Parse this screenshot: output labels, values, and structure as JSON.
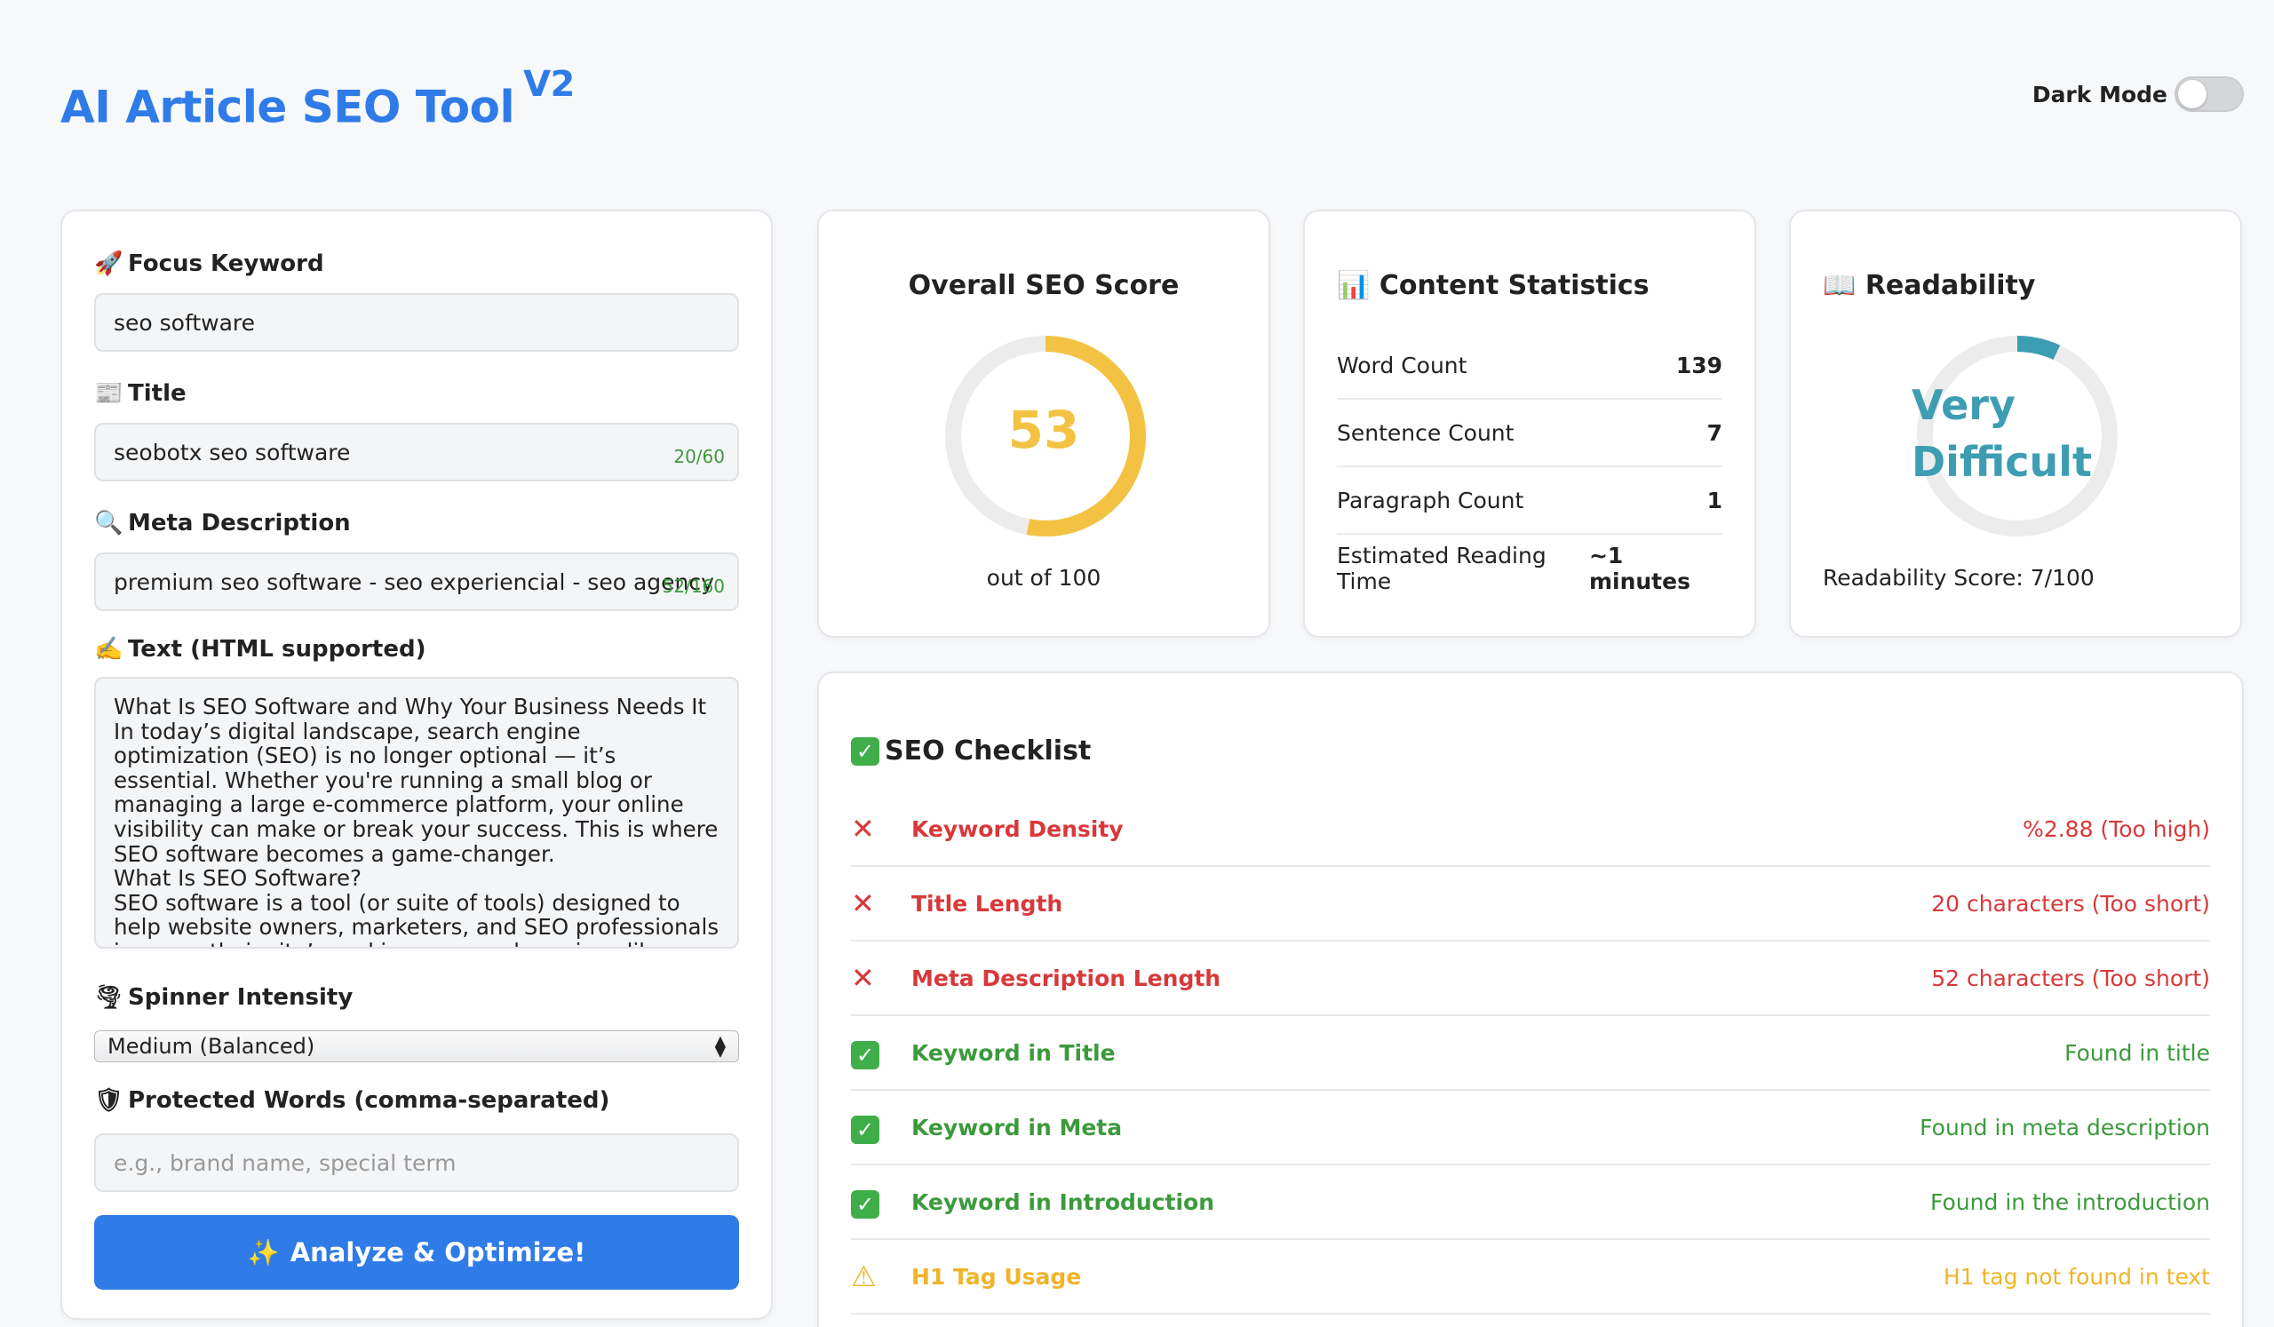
{
  "header": {
    "title": "AI Article SEO Tool",
    "version": "V2",
    "dark_mode_label": "Dark Mode",
    "dark_mode_on": false
  },
  "form": {
    "focus_keyword": {
      "icon": "🚀",
      "label": "Focus Keyword",
      "value": "seo software"
    },
    "title": {
      "icon": "📰",
      "label": "Title",
      "value": "seobotx seo software",
      "counter": "20/60"
    },
    "meta": {
      "icon": "🔍",
      "label": "Meta Description",
      "value": "premium seo software - seo experiencial - seo agency",
      "counter": "52/160"
    },
    "text": {
      "icon": "✍️",
      "label": "Text (HTML supported)",
      "value": "What Is SEO Software and Why Your Business Needs It\nIn today’s digital landscape, search engine optimization (SEO) is no longer optional — it’s essential. Whether you're running a small blog or managing a large e-commerce platform, your online visibility can make or break your success. This is where SEO software becomes a game-changer.\nWhat Is SEO Software?\nSEO software is a tool (or suite of tools) designed to help website owners, marketers, and SEO professionals improve their site’s ranking on search engines like Google, Bing, and Yahoo. It automates and simplifies many aspects of SEO"
    },
    "spinner": {
      "icon": "🌪",
      "label": "Spinner Intensity",
      "value": "Medium (Balanced)"
    },
    "protected": {
      "icon": "🛡",
      "label": "Protected Words (comma-separated)",
      "placeholder": "e.g., brand name, special term"
    },
    "analyze_button": "Analyze & Optimize!",
    "analyze_icon": "✨"
  },
  "seo_score": {
    "title": "Overall SEO Score",
    "score": "53",
    "score_fraction": 0.53,
    "subtitle": "out of 100",
    "color": "#f4c242"
  },
  "stats": {
    "icon": "📊",
    "title": "Content Statistics",
    "rows": [
      {
        "label": "Word Count",
        "value": "139"
      },
      {
        "label": "Sentence Count",
        "value": "7"
      },
      {
        "label": "Paragraph Count",
        "value": "1"
      },
      {
        "label": "Estimated Reading Time",
        "value": "~1 minutes"
      }
    ]
  },
  "readability": {
    "icon": "📖",
    "title": "Readability",
    "level_line1": "Very",
    "level_line2": "Difficult",
    "score_fraction": 0.07,
    "score_text": "Readability Score: 7/100",
    "color": "#3d9db3"
  },
  "checklist": {
    "icon": "✅",
    "title": "SEO Checklist",
    "items": [
      {
        "status": "fail",
        "name": "Keyword Density",
        "result": "%2.88 (Too high)"
      },
      {
        "status": "fail",
        "name": "Title Length",
        "result": "20 characters (Too short)"
      },
      {
        "status": "fail",
        "name": "Meta Description Length",
        "result": "52 characters (Too short)"
      },
      {
        "status": "pass",
        "name": "Keyword in Title",
        "result": "Found in title"
      },
      {
        "status": "pass",
        "name": "Keyword in Meta",
        "result": "Found in meta description"
      },
      {
        "status": "pass",
        "name": "Keyword in Introduction",
        "result": "Found in the introduction"
      },
      {
        "status": "warn",
        "name": "H1 Tag Usage",
        "result": "H1 tag not found in text"
      }
    ]
  }
}
